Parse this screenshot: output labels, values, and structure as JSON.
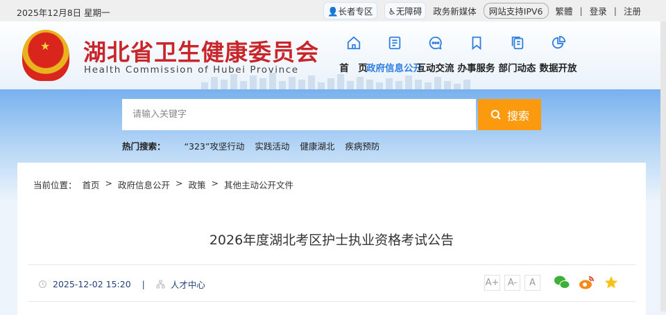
{
  "topbar": {
    "date": "2025年12月8日 星期一",
    "elder": "长者专区",
    "accessible": "无障碍",
    "media": "政务新媒体",
    "ipv6": "网站支持IPV6",
    "traditional": "繁體",
    "login": "登录",
    "register": "注册",
    "sep": "|"
  },
  "header": {
    "title": "湖北省卫生健康委员会",
    "subtitle": "Health Commission of Hubei Province"
  },
  "nav": [
    {
      "label": "首　页",
      "icon": "home-icon"
    },
    {
      "label": "政府信息公开",
      "icon": "document-icon"
    },
    {
      "label": "互动交流",
      "icon": "chat-icon"
    },
    {
      "label": "办事服务",
      "icon": "bookmark-icon"
    },
    {
      "label": "部门动态",
      "icon": "copy-icon"
    },
    {
      "label": "数据开放",
      "icon": "pie-chart-icon"
    }
  ],
  "search": {
    "placeholder": "请输入关键字",
    "button": "搜索",
    "hot_label": "热门搜索：",
    "hot": [
      "“323”攻坚行动",
      "实践活动",
      "健康湖北",
      "疾病预防"
    ]
  },
  "breadcrumb": {
    "label": "当前位置：",
    "items": [
      "首页",
      "政府信息公开",
      "政策",
      "其他主动公开文件"
    ],
    "sep": ">"
  },
  "article": {
    "title": "2026年度湖北考区护士执业资格考试公告",
    "datetime": "2025-12-02 15:20",
    "source": "人才中心",
    "sep": "|",
    "font_buttons": [
      "A+",
      "A-",
      "A"
    ]
  },
  "colors": {
    "accent": "#2f7fe0",
    "brand": "#c8262b",
    "search_button": "#fb9a0e"
  }
}
